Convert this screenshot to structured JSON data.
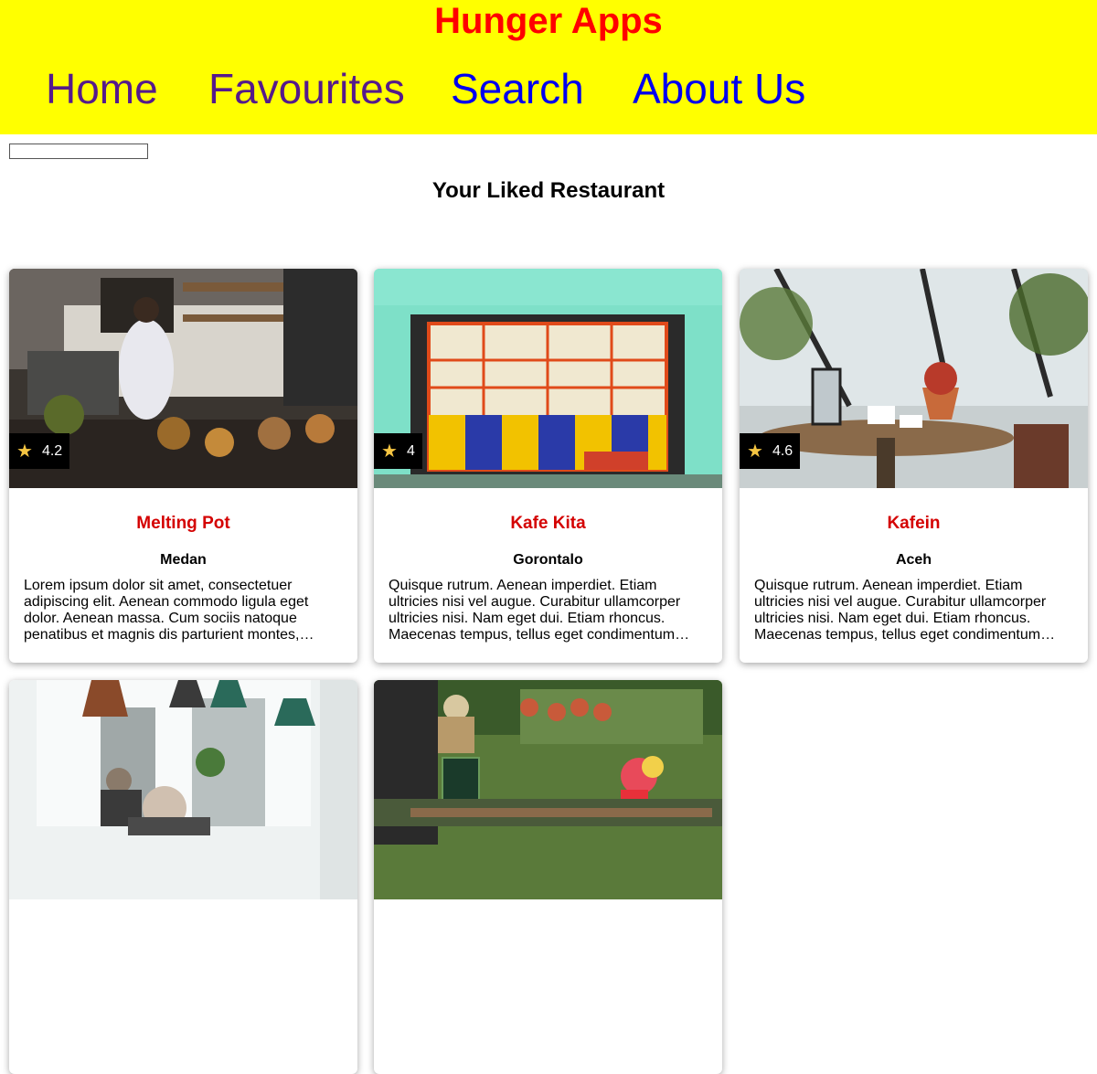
{
  "header": {
    "title": "Hunger Apps",
    "nav": [
      "Home",
      "Favourites",
      "Search",
      "About Us"
    ]
  },
  "search": {
    "value": ""
  },
  "page_title": "Your Liked Restaurant",
  "restaurants": [
    {
      "name": "Melting Pot",
      "city": "Medan",
      "rating": "4.2",
      "description": "Lorem ipsum dolor sit amet, consectetuer adipiscing elit. Aenean commodo ligula eget dolor. Aenean massa. Cum sociis natoque penatibus et magnis dis parturient montes, nascetur ridiculus mus."
    },
    {
      "name": "Kafe Kita",
      "city": "Gorontalo",
      "rating": "4",
      "description": "Quisque rutrum. Aenean imperdiet. Etiam ultricies nisi vel augue. Curabitur ullamcorper ultricies nisi. Nam eget dui. Etiam rhoncus. Maecenas tempus, tellus eget condimentum rhoncus."
    },
    {
      "name": "Kafein",
      "city": "Aceh",
      "rating": "4.6",
      "description": "Quisque rutrum. Aenean imperdiet. Etiam ultricies nisi vel augue. Curabitur ullamcorper ultricies nisi. Nam eget dui. Etiam rhoncus. Maecenas tempus, tellus eget condimentum rhoncus."
    },
    {},
    {}
  ],
  "colors": {
    "header_bg": "#ffff00",
    "title": "#ff0000",
    "restaurant_name": "#d40000",
    "star": "#f5c542"
  }
}
